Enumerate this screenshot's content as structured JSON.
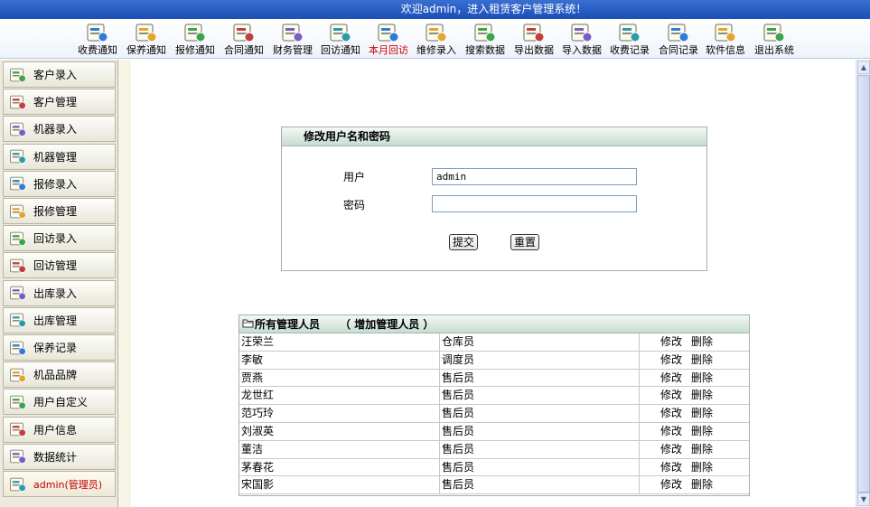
{
  "title_bar": "欢迎admin，进入租赁客户管理系统！",
  "toolbar": [
    {
      "label": "收费通知",
      "icon": "money-note-icon"
    },
    {
      "label": "保养通知",
      "icon": "maintenance-notice-icon"
    },
    {
      "label": "报修通知",
      "icon": "repair-notice-icon"
    },
    {
      "label": "合同通知",
      "icon": "contract-notice-icon"
    },
    {
      "label": "财务管理",
      "icon": "finance-icon"
    },
    {
      "label": "回访通知",
      "icon": "revisit-notice-icon"
    },
    {
      "label": "本月回访",
      "icon": "month-revisit-icon",
      "active": true
    },
    {
      "label": "维修录入",
      "icon": "repair-entry-icon"
    },
    {
      "label": "搜索数据",
      "icon": "search-data-icon"
    },
    {
      "label": "导出数据",
      "icon": "export-data-icon"
    },
    {
      "label": "导入数据",
      "icon": "import-data-icon"
    },
    {
      "label": "收费记录",
      "icon": "fee-record-icon"
    },
    {
      "label": "合同记录",
      "icon": "contract-record-icon"
    },
    {
      "label": "软件信息",
      "icon": "software-info-icon"
    },
    {
      "label": "退出系统",
      "icon": "exit-icon"
    }
  ],
  "sidebar": [
    {
      "label": "客户录入",
      "icon": "customer-entry-icon"
    },
    {
      "label": "客户管理",
      "icon": "customer-manage-icon"
    },
    {
      "label": "机器录入",
      "icon": "machine-entry-icon"
    },
    {
      "label": "机器管理",
      "icon": "machine-manage-icon"
    },
    {
      "label": "报修录入",
      "icon": "repair-report-entry-icon"
    },
    {
      "label": "报修管理",
      "icon": "repair-report-manage-icon"
    },
    {
      "label": "回访录入",
      "icon": "revisit-entry-icon"
    },
    {
      "label": "回访管理",
      "icon": "revisit-manage-icon"
    },
    {
      "label": "出库录入",
      "icon": "outbound-entry-icon"
    },
    {
      "label": "出库管理",
      "icon": "outbound-manage-icon"
    },
    {
      "label": "保养记录",
      "icon": "maintenance-record-icon"
    },
    {
      "label": "机品品牌",
      "icon": "brand-icon"
    },
    {
      "label": "用户自定义",
      "icon": "user-custom-icon"
    },
    {
      "label": "用户信息",
      "icon": "user-info-icon"
    },
    {
      "label": "数据统计",
      "icon": "statistics-icon"
    },
    {
      "label": "admin(管理员)",
      "icon": "admin-home-icon",
      "admin": true
    }
  ],
  "edit_form": {
    "header": "修改用户名和密码",
    "user_label": "用户",
    "user_value": "admin",
    "password_label": "密码",
    "password_value": "",
    "submit_label": "提交",
    "reset_label": "重置"
  },
  "admin_table": {
    "title": "所有管理人员",
    "add_link": "（ 增加管理人员 ）",
    "edit_label": "修改",
    "delete_label": "删除",
    "rows": [
      {
        "name": "汪荣兰",
        "role": "仓库员"
      },
      {
        "name": "李敏",
        "role": "调度员"
      },
      {
        "name": "贾燕",
        "role": "售后员"
      },
      {
        "name": "龙世红",
        "role": "售后员"
      },
      {
        "name": "范巧玲",
        "role": "售后员"
      },
      {
        "name": "刘淑英",
        "role": "售后员"
      },
      {
        "name": "董洁",
        "role": "售后员"
      },
      {
        "name": "茅春花",
        "role": "售后员"
      },
      {
        "name": "宋国影",
        "role": "售后员"
      }
    ]
  }
}
